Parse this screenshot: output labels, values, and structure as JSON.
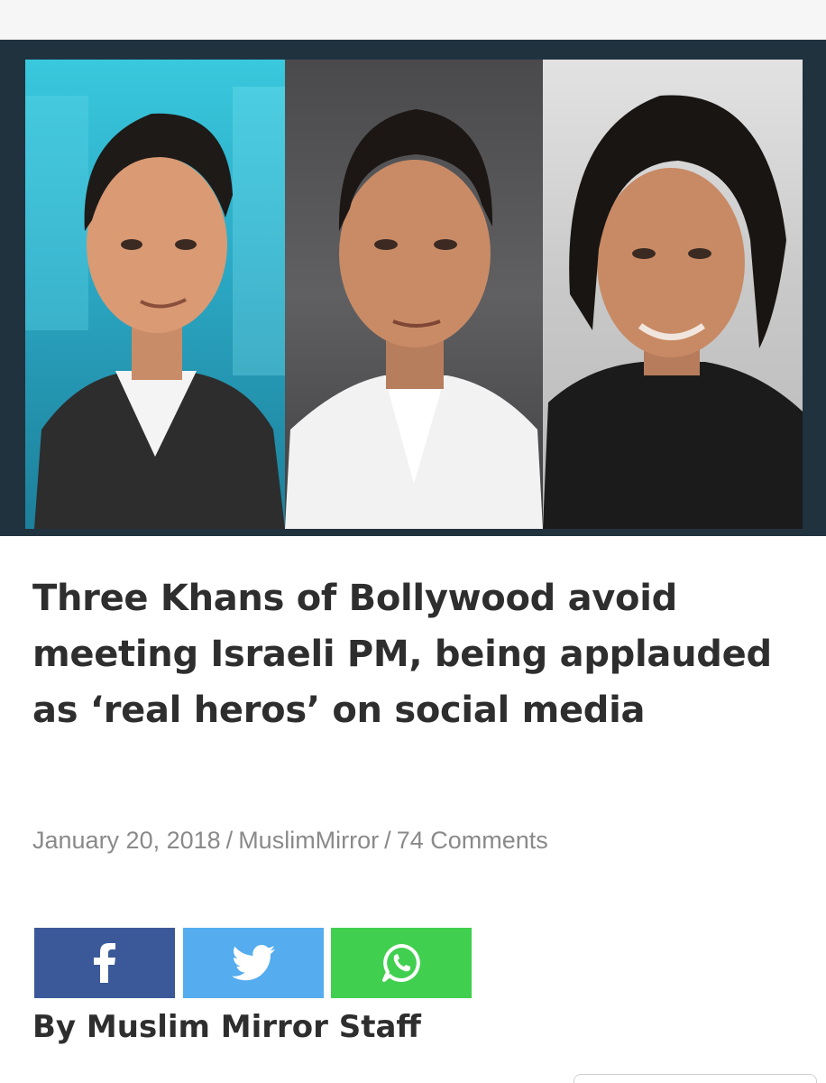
{
  "article": {
    "title": "Three Khans of Bollywood avoid meeting Israeli PM, being applauded as ‘real heros’ on social media",
    "date": "January 20, 2018",
    "author_link": "MuslimMirror",
    "comments": "74 Comments",
    "separator": "/",
    "byline": "By Muslim Mirror Staff"
  },
  "share": {
    "facebook_icon": "facebook-icon",
    "twitter_icon": "twitter-icon",
    "whatsapp_icon": "whatsapp-icon"
  },
  "colors": {
    "hero_frame": "#21323f",
    "facebook": "#3b5998",
    "twitter": "#55acee",
    "whatsapp": "#41cf4f",
    "headline": "#2e2e2e",
    "meta": "#8a8a8a"
  }
}
